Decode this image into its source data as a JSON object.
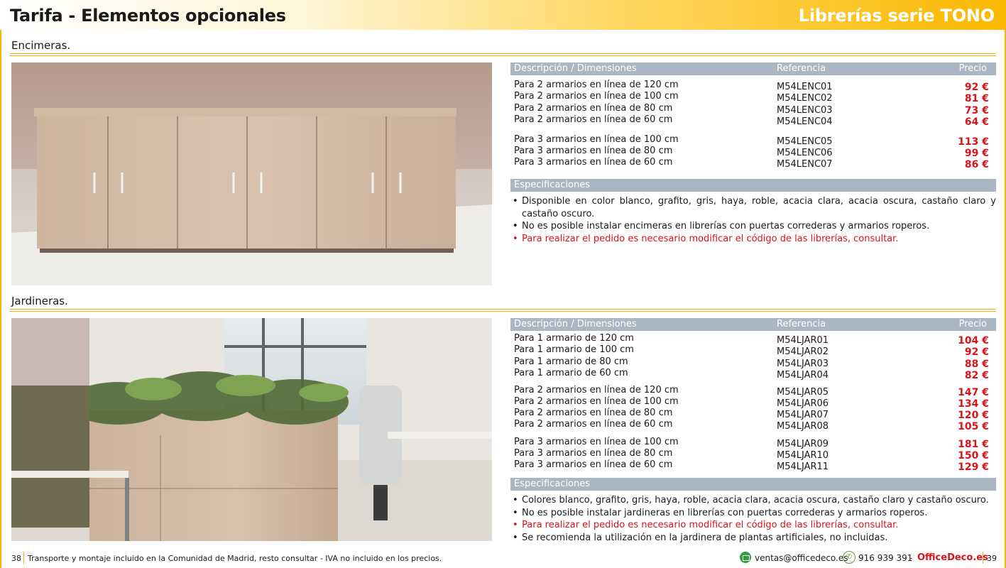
{
  "header": {
    "title": "Tarifa - Elementos opcionales",
    "series": "Librerías serie TONO"
  },
  "columns": {
    "desc": "Descripción / Dimensiones",
    "ref": "Referencia",
    "price": "Precio"
  },
  "encimeras": {
    "label": "Encimeras.",
    "rows": [
      {
        "desc": "Para 2 armarios en línea de 120 cm",
        "ref": "M54LENC01",
        "price": "92 €"
      },
      {
        "desc": "Para 2 armarios en línea de 100 cm",
        "ref": "M54LENC02",
        "price": "81 €"
      },
      {
        "desc": "Para 2 armarios en línea de 80 cm",
        "ref": "M54LENC03",
        "price": "73 €"
      },
      {
        "desc": "Para 2 armarios en línea de 60 cm",
        "ref": "M54LENC04",
        "price": "64 €"
      },
      {
        "desc": "Para 3 armarios en línea de 100 cm",
        "ref": "M54LENC05",
        "price": "113 €"
      },
      {
        "desc": "Para 3 armarios en línea de 80 cm",
        "ref": "M54LENC06",
        "price": "99 €"
      },
      {
        "desc": "Para 3 armarios en línea de 60 cm",
        "ref": "M54LENC07",
        "price": "86 €"
      }
    ],
    "spec_title": "Especificaciones",
    "specs": [
      "Disponible en color blanco, grafito, gris, haya, roble, acacia clara, acacia oscura, castaño claro y castaño oscuro.",
      "No es posible instalar encimeras en librerías con puertas correderas y armarios roperos.",
      "Para realizar el pedido es necesario modificar el código de las librerías, consultar."
    ]
  },
  "jardineras": {
    "label": "Jardineras.",
    "rows": [
      {
        "desc": "Para 1 armario de 120 cm",
        "ref": "M54LJAR01",
        "price": "104 €"
      },
      {
        "desc": "Para 1 armario de 100 cm",
        "ref": "M54LJAR02",
        "price": "92 €"
      },
      {
        "desc": "Para 1 armario de 80 cm",
        "ref": "M54LJAR03",
        "price": "88 €"
      },
      {
        "desc": "Para 1 armario de 60 cm",
        "ref": "M54LJAR04",
        "price": "82 €"
      },
      {
        "desc": "Para 2 armarios en línea de 120 cm",
        "ref": "M54LJAR05",
        "price": "147 €"
      },
      {
        "desc": "Para 2 armarios en línea de 100 cm",
        "ref": "M54LJAR06",
        "price": "134 €"
      },
      {
        "desc": "Para 2 armarios en línea de 80 cm",
        "ref": "M54LJAR07",
        "price": "120 €"
      },
      {
        "desc": "Para 2 armarios en línea de 60 cm",
        "ref": "M54LJAR08",
        "price": "105 €"
      },
      {
        "desc": "Para 3 armarios en línea de 100 cm",
        "ref": "M54LJAR09",
        "price": "181 €"
      },
      {
        "desc": "Para 3 armarios en línea de 80 cm",
        "ref": "M54LJAR10",
        "price": "150 €"
      },
      {
        "desc": "Para 3 armarios en línea de 60 cm",
        "ref": "M54LJAR11",
        "price": "129 €"
      }
    ],
    "spec_title": "Especificaciones",
    "specs": [
      "Colores blanco, grafito, gris, haya, roble, acacia clara, acacia oscura, castaño claro y castaño oscuro.",
      "No es posible instalar jardineras en librerías con puertas correderas y armarios roperos.",
      "Para realizar el pedido es necesario modificar el código de las librerías, consultar.",
      "Se recomienda la utilización en la jardinera de plantas artificiales, no incluidas."
    ]
  },
  "footer": {
    "page_left": "38",
    "page_right": "39",
    "note": "Transporte y montaje incluido en la Comunidad de Madrid, resto consultar - IVA no incluido en los precios.",
    "email": "ventas@officedeco.es",
    "phone": "916 939 391",
    "dash": "-",
    "brand": "OfficeDeco.es"
  },
  "colors": {
    "accent": "#f9b800",
    "table_header": "#a9b7c4",
    "price_red": "#d8141b"
  },
  "icons": {
    "email": "email-icon",
    "phone": "phone-icon"
  }
}
